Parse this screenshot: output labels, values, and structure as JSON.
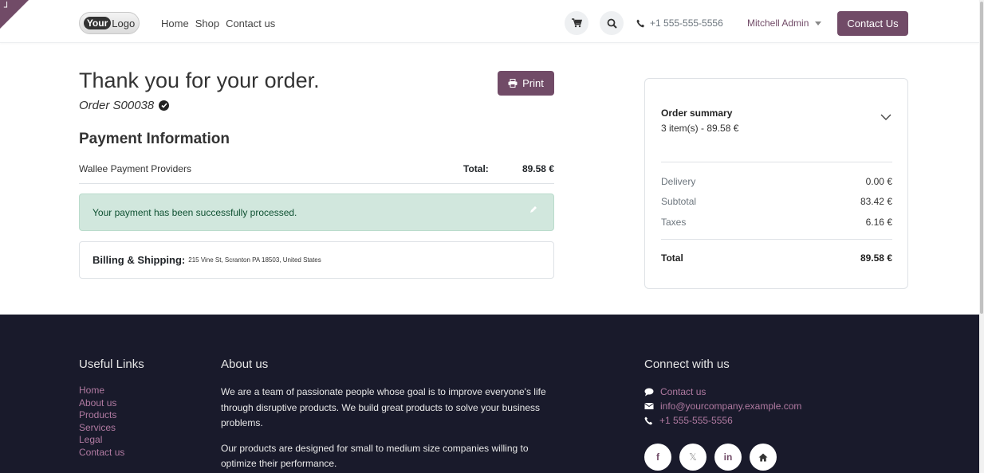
{
  "header": {
    "logo_text_bold": "Your",
    "logo_text_light": "Logo",
    "nav": [
      "Home",
      "Shop",
      "Contact us"
    ],
    "phone": "+1 555-555-5556",
    "user": "Mitchell Admin",
    "cta": "Contact Us"
  },
  "main": {
    "heading": "Thank you for your order.",
    "order_ref": "Order S00038",
    "print_label": "Print",
    "payment_title": "Payment Information",
    "provider": "Wallee Payment Providers",
    "total_label": "Total:",
    "total_value": "89.58 €",
    "alert": "Your payment has been successfully processed.",
    "billing_label": "Billing & Shipping:",
    "billing_address": "215 Vine St, Scranton PA 18503, United States"
  },
  "summary": {
    "title": "Order summary",
    "subtitle": "3 item(s) -  89.58 €",
    "rows": [
      {
        "label": "Delivery",
        "value": "0.00 €"
      },
      {
        "label": "Subtotal",
        "value": "83.42 €"
      },
      {
        "label": "Taxes",
        "value": "6.16 €"
      }
    ],
    "total_label": "Total",
    "total_value": "89.58 €"
  },
  "footer": {
    "useful_title": "Useful Links",
    "useful_links": [
      "Home",
      "About us",
      "Products",
      "Services",
      "Legal",
      "Contact us"
    ],
    "about_title": "About us",
    "about_p1": "We are a team of passionate people whose goal is to improve everyone's life through disruptive products. We build great products to solve your business problems.",
    "about_p2": "Our products are designed for small to medium size companies willing to optimize their performance.",
    "connect_title": "Connect with us",
    "connect_contact": "Contact us",
    "connect_email": "info@yourcompany.example.com",
    "connect_phone": "+1 555-555-5556",
    "socials": [
      "f",
      "𝕏",
      "in",
      "home"
    ]
  },
  "colors": {
    "brand": "#714b67",
    "footer_bg": "#191a2b",
    "alert_bg": "#d1e7dd",
    "alert_text": "#0f5132"
  }
}
